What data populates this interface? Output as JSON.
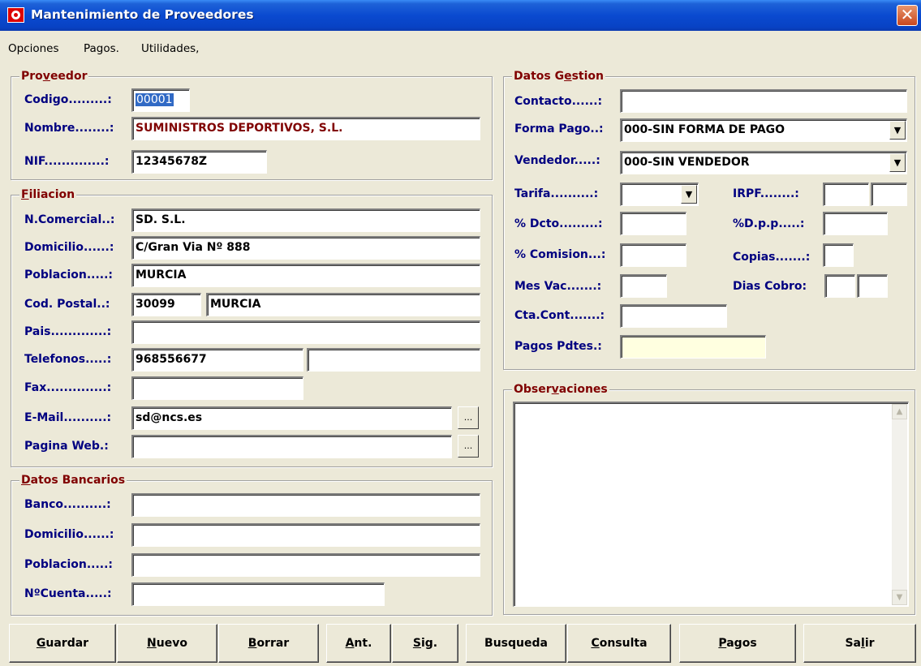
{
  "window": {
    "title": "Mantenimiento de Proveedores",
    "close_glyph": "✕"
  },
  "menu": [
    "Opciones",
    "Pagos.",
    "Utilidades,"
  ],
  "proveedor": {
    "legend_pre": "Pro",
    "legend_key": "v",
    "legend_post": "eedor",
    "codigo_label": "Codigo.........:",
    "codigo_value": "00001",
    "nombre_label": "Nombre........:",
    "nombre_value": "SUMINISTROS DEPORTIVOS, S.L.",
    "nif_label": "NIF..............:",
    "nif_value": "12345678Z"
  },
  "filiacion": {
    "legend_key": "F",
    "legend_post": "iliacion",
    "ncomercial_label": "N.Comercial..:",
    "ncomercial_value": "SD. S.L.",
    "domicilio_label": "Domicilio......:",
    "domicilio_value": "C/Gran Via Nº 888",
    "poblacion_label": "Poblacion.....:",
    "poblacion_value": "MURCIA",
    "codpostal_label": "Cod. Postal..:",
    "codpostal_value": "30099",
    "codpostal_city": "MURCIA",
    "pais_label": "Pais.............:",
    "pais_value": "",
    "telefonos_label": "Telefonos.....:",
    "telefono1": "968556677",
    "telefono2": "",
    "fax_label": "Fax..............:",
    "fax_value": "",
    "email_label": "E-Mail..........:",
    "email_value": "sd@ncs.es",
    "web_label": "Pagina Web.:",
    "web_value": "",
    "browse_glyph": "..."
  },
  "bancarios": {
    "legend_key": "D",
    "legend_post": "atos Bancarios",
    "banco_label": "Banco..........:",
    "banco_value": "",
    "domicilio_label": "Domicilio......:",
    "domicilio_value": "",
    "poblacion_label": "Poblacion.....:",
    "poblacion_value": "",
    "cuenta_label": "NºCuenta.....:",
    "cuenta_value": ""
  },
  "gestion": {
    "legend_pre": "Datos G",
    "legend_key": "e",
    "legend_post": "stion",
    "contacto_label": "Contacto......:",
    "contacto_value": "",
    "formapago_label": "Forma Pago..:",
    "formapago_value": "000-SIN FORMA DE PAGO",
    "vendedor_label": "Vendedor.....:",
    "vendedor_value": "000-SIN VENDEDOR",
    "tarifa_label": "Tarifa..........:",
    "tarifa_value": "",
    "irpf_label": "IRPF........:",
    "irpf_value1": "",
    "irpf_value2": "",
    "dcto_label": "% Dcto.........:",
    "dcto_value": "",
    "dpp_label": "%D.p.p.....:",
    "dpp_value": "",
    "comision_label": "% Comision...:",
    "comision_value": "",
    "copias_label": "Copias.......:",
    "copias_value": "",
    "mesvac_label": "Mes Vac.......:",
    "mesvac_value": "",
    "diascobro_label": "Dias Cobro:",
    "diascobro_value1": "",
    "diascobro_value2": "",
    "ctacont_label": "Cta.Cont.......:",
    "ctacont_value": "",
    "pagospdtes_label": "Pagos Pdtes.:",
    "pagospdtes_value": "",
    "dropdown_glyph": "▼"
  },
  "observaciones": {
    "legend_pre": "Obser",
    "legend_key": "v",
    "legend_post": "aciones",
    "value": "",
    "up_glyph": "▲",
    "down_glyph": "▼"
  },
  "buttons": {
    "guardar_key": "G",
    "guardar_post": "uardar",
    "nuevo_key": "N",
    "nuevo_post": "uevo",
    "borrar_key": "B",
    "borrar_post": "orrar",
    "ant_key": "A",
    "ant_post": "nt.",
    "sig_key": "S",
    "sig_post": "ig.",
    "busqueda": "Busqueda",
    "consulta_key": "C",
    "consulta_post": "onsulta",
    "pagos_key": "P",
    "pagos_post": "agos",
    "salir_pre": "Sa",
    "salir_key": "l",
    "salir_post": "ir"
  }
}
